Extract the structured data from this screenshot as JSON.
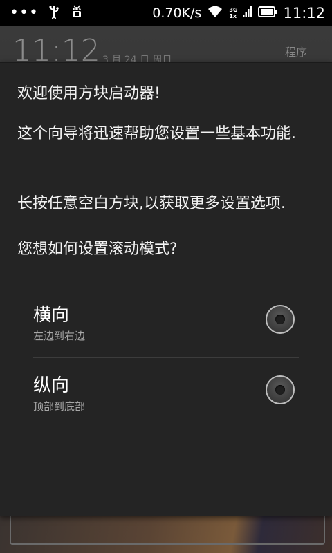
{
  "status_bar": {
    "overflow_dots": "•••",
    "net_speed": "0.70K/s",
    "net_type_top": "3G",
    "net_type_bottom": "1x",
    "time": "11:12",
    "icons": [
      "usb-icon",
      "android-debug-icon",
      "wifi-icon",
      "signal-icon",
      "battery-icon"
    ]
  },
  "background": {
    "clock": "11:12",
    "date": "3 月 24 日 周日",
    "apps_label": "程序"
  },
  "dialog": {
    "title": "欢迎使用方块启动器!",
    "intro": "这个向导将迅速帮助您设置一些基本功能.",
    "hint": "长按任意空白方块,以获取更多设置选项.",
    "question": "您想如何设置滚动模式?",
    "options": [
      {
        "title": "横向",
        "subtitle": "左边到右边",
        "selected": false
      },
      {
        "title": "纵向",
        "subtitle": "顶部到底部",
        "selected": false
      }
    ]
  },
  "colors": {
    "dialog_bg": "#242424",
    "status_bar_bg": "#000000",
    "text_primary": "#ffffff",
    "text_secondary": "#a8a8a8"
  }
}
